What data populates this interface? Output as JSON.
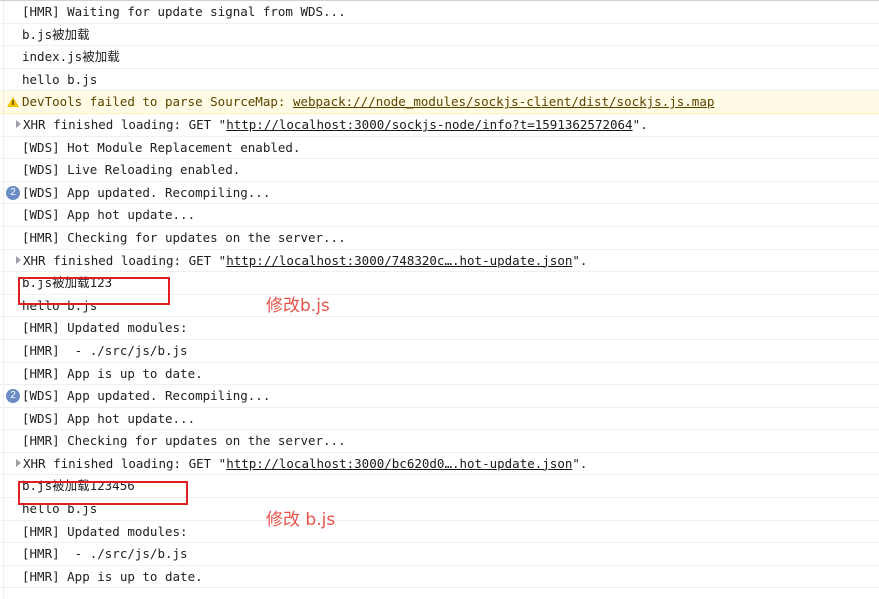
{
  "console": {
    "name": "browser-devtools-console",
    "background": "#ffffff",
    "text_color": "#202124",
    "warning_bg": "#fffbe5",
    "badge_color": "#6b8cc4",
    "annotation_color": "#e8534a",
    "annotation_box_color": "#e02020",
    "rows": [
      {
        "id": "r1",
        "type": "log",
        "text": "[HMR] Waiting for update signal from WDS..."
      },
      {
        "id": "r2",
        "type": "log",
        "text": "b.js被加载"
      },
      {
        "id": "r3",
        "type": "log",
        "text": "index.js被加载"
      },
      {
        "id": "r4",
        "type": "log",
        "text": "hello b.js"
      },
      {
        "id": "r5",
        "type": "warning",
        "icon": "warning-triangle-icon",
        "text_before": "DevTools failed to parse SourceMap: ",
        "link": "webpack:///node_modules/sockjs-client/dist/sockjs.js.map",
        "text_after": ""
      },
      {
        "id": "r6",
        "type": "xhr",
        "icon": "disclosure-triangle-icon",
        "text_before": "XHR finished loading: GET \"",
        "link": "http://localhost:3000/sockjs-node/info?t=1591362572064",
        "text_after": "\"."
      },
      {
        "id": "r7",
        "type": "log",
        "text": "[WDS] Hot Module Replacement enabled."
      },
      {
        "id": "r8",
        "type": "log",
        "text": "[WDS] Live Reloading enabled."
      },
      {
        "id": "r9",
        "type": "log",
        "badge": "2",
        "text": "[WDS] App updated. Recompiling..."
      },
      {
        "id": "r10",
        "type": "log",
        "text": "[WDS] App hot update..."
      },
      {
        "id": "r11",
        "type": "log",
        "text": "[HMR] Checking for updates on the server..."
      },
      {
        "id": "r12",
        "type": "xhr",
        "icon": "disclosure-triangle-icon",
        "text_before": "XHR finished loading: GET \"",
        "link": "http://localhost:3000/748320c….hot-update.json",
        "text_after": "\"."
      },
      {
        "id": "r13",
        "type": "log",
        "text": "b.js被加载123"
      },
      {
        "id": "r14",
        "type": "log",
        "text": "hello b.js"
      },
      {
        "id": "r15",
        "type": "log",
        "text": "[HMR] Updated modules:"
      },
      {
        "id": "r16",
        "type": "log",
        "text": "[HMR]  - ./src/js/b.js"
      },
      {
        "id": "r17",
        "type": "log",
        "text": "[HMR] App is up to date."
      },
      {
        "id": "r18",
        "type": "log",
        "badge": "2",
        "text": "[WDS] App updated. Recompiling..."
      },
      {
        "id": "r19",
        "type": "log",
        "text": "[WDS] App hot update..."
      },
      {
        "id": "r20",
        "type": "log",
        "text": "[HMR] Checking for updates on the server..."
      },
      {
        "id": "r21",
        "type": "xhr",
        "icon": "disclosure-triangle-icon",
        "text_before": "XHR finished loading: GET \"",
        "link": "http://localhost:3000/bc620d0….hot-update.json",
        "text_after": "\"."
      },
      {
        "id": "r22",
        "type": "log",
        "text": "b.js被加载123456"
      },
      {
        "id": "r23",
        "type": "log",
        "text": "hello b.js"
      },
      {
        "id": "r24",
        "type": "log",
        "text": "[HMR] Updated modules:"
      },
      {
        "id": "r25",
        "type": "log",
        "text": "[HMR]  - ./src/js/b.js"
      },
      {
        "id": "r26",
        "type": "log",
        "text": "[HMR] App is up to date."
      }
    ]
  },
  "annotations": {
    "box_1": {
      "label": "highlight-box-b-js-123"
    },
    "box_2": {
      "label": "highlight-box-b-js-123456"
    },
    "note_1": "修改b.js",
    "note_2": "修改 b.js"
  }
}
